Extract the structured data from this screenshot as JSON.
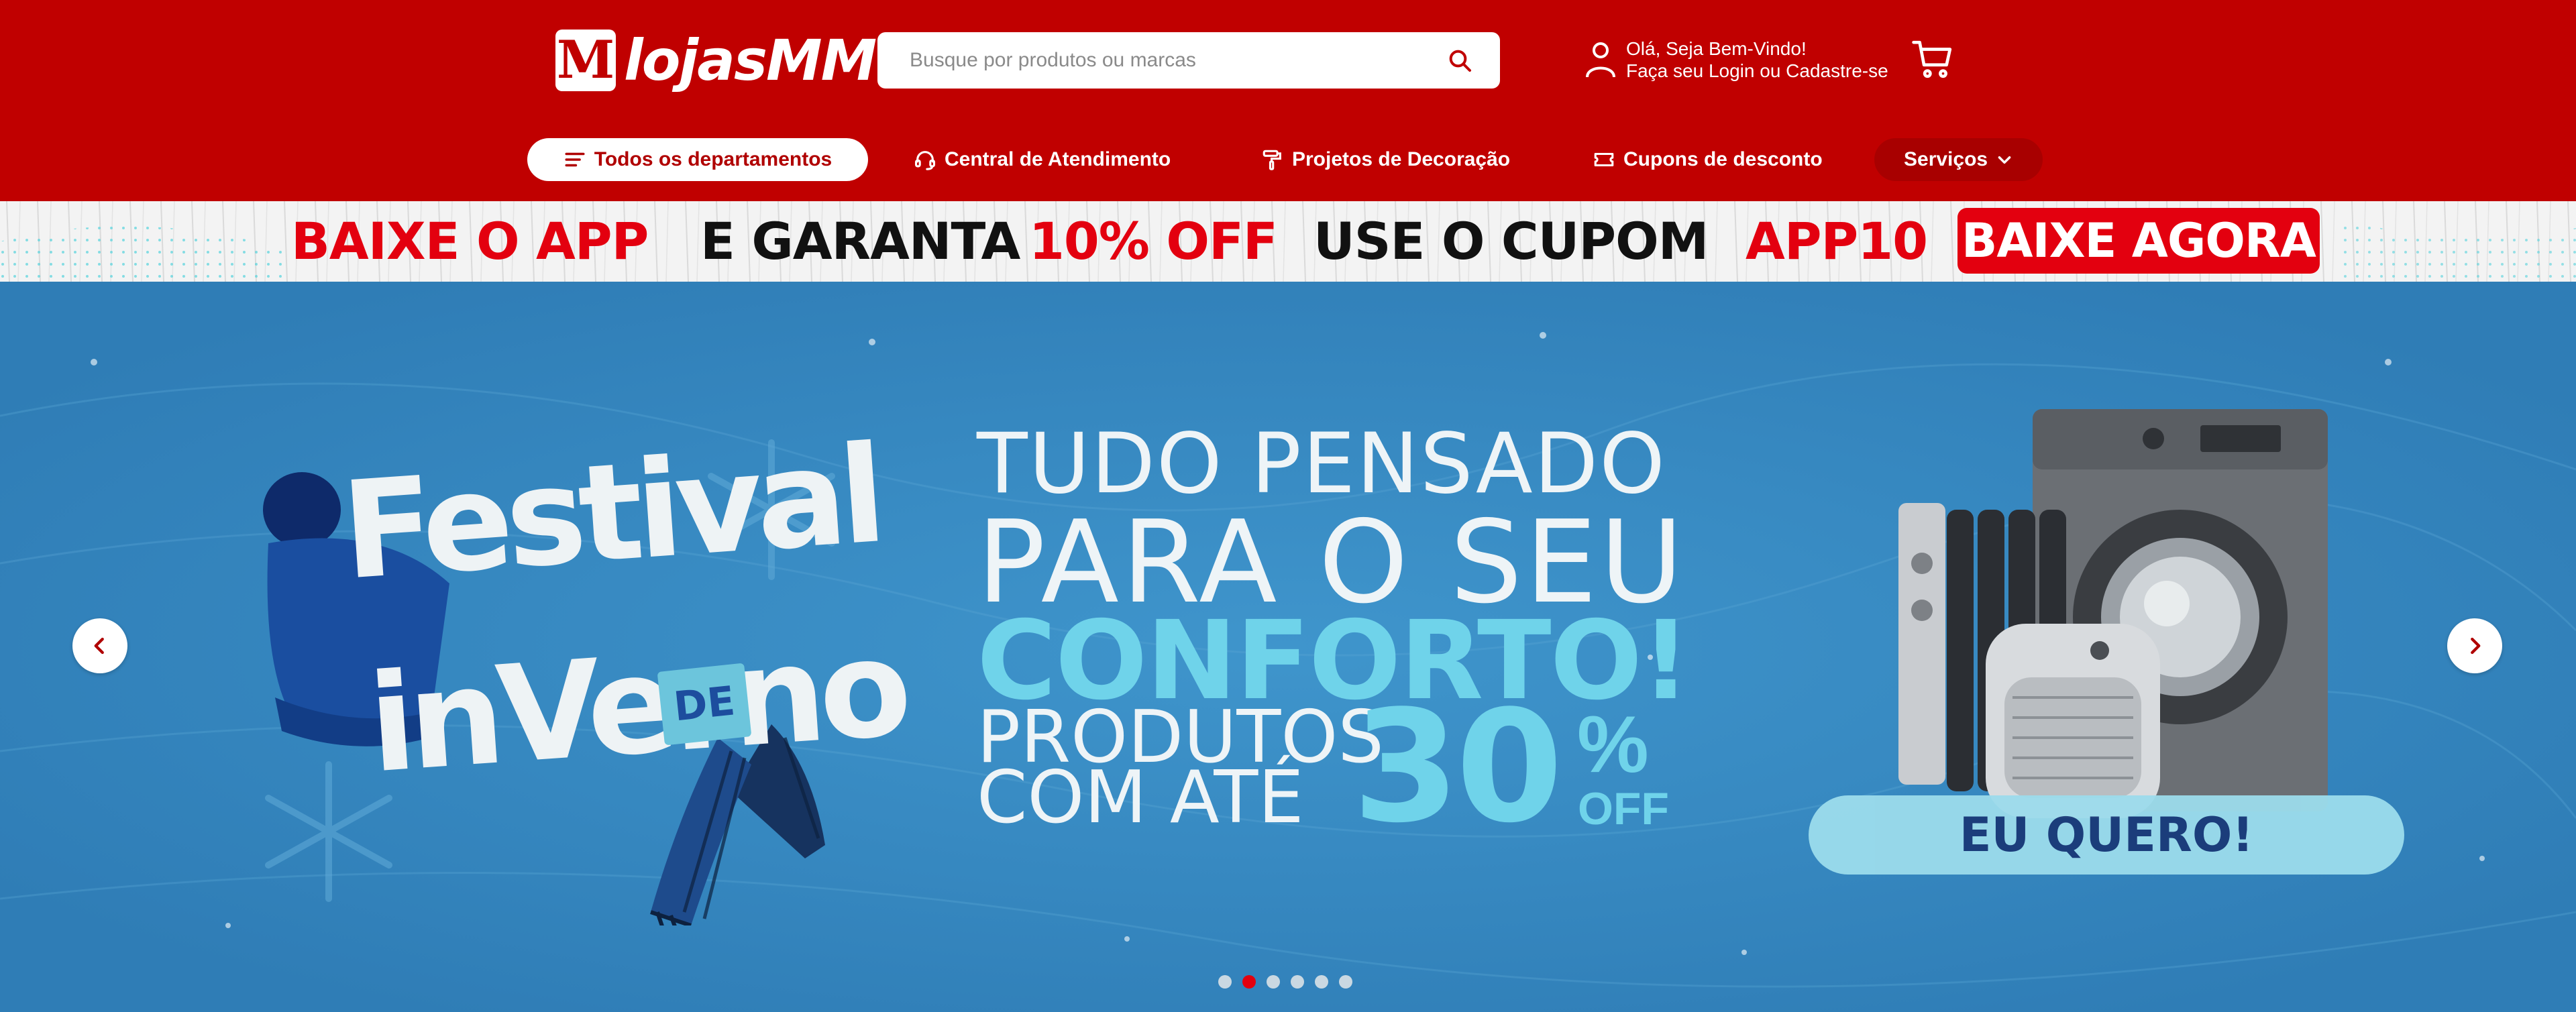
{
  "header": {
    "logo_mark": "M",
    "logo_text": "lojasMM",
    "search": {
      "placeholder": "Busque por produtos ou marcas",
      "value": ""
    },
    "account": {
      "greeting": "Olá, Seja Bem-Vindo!",
      "login_text": "Faça seu Login ou Cadastre-se"
    },
    "cart_icon": "cart-icon"
  },
  "nav": {
    "items": [
      {
        "label": "Todos os departamentos",
        "icon": "menu-icon"
      },
      {
        "label": "Central de Atendimento",
        "icon": "headset-icon"
      },
      {
        "label": "Projetos de Decoração",
        "icon": "paint-roller-icon"
      },
      {
        "label": "Cupons de desconto",
        "icon": "ticket-icon"
      },
      {
        "label": "Serviços",
        "icon": "chevron-down-icon"
      }
    ]
  },
  "promo": {
    "part1": "BAIXE O APP",
    "part2": "E GARANTA",
    "part3": "10% OFF",
    "part4": "USE O CUPOM",
    "part5": "APP10",
    "button": "BAIXE AGORA"
  },
  "hero": {
    "festival_word": "Festival",
    "festival_de": "DE",
    "festival_inverno": "inVerno",
    "line1": "TUDO PENSADO",
    "line2": "PARA O SEU",
    "line3": "CONFORTO!",
    "line4": "PRODUTOS",
    "line5": "COM ATÉ",
    "discount": "30",
    "discount_sign": "%",
    "discount_off": "OFF",
    "cta": "EU QUERO!",
    "slide_count": 6,
    "active_slide": 2
  },
  "colors": {
    "brand_red": "#c00000",
    "promo_red": "#e3000f",
    "hero_blue": "#3b8dc4",
    "hero_cyan": "#6fd3ea"
  }
}
